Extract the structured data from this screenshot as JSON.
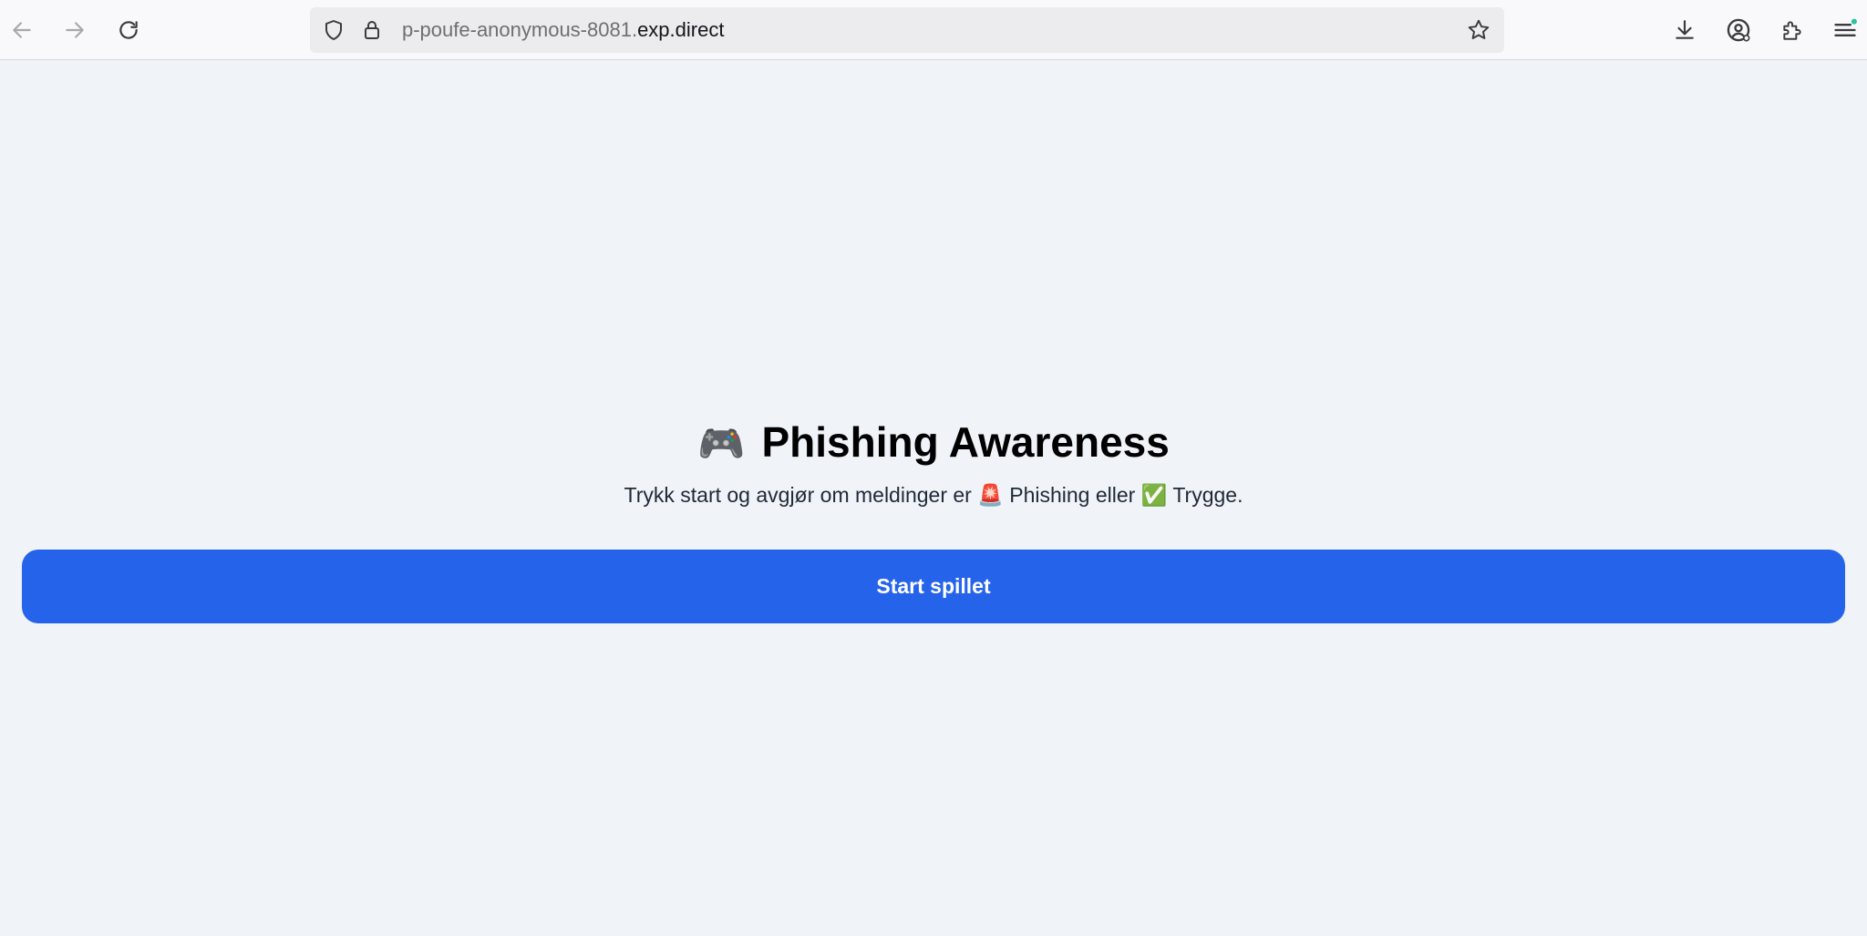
{
  "browser": {
    "url_subdomain": "p-poufe-anonymous-8081.",
    "url_domain": "exp.direct",
    "icons": {
      "back": "arrow-left-icon",
      "forward": "arrow-right-icon",
      "reload": "reload-icon",
      "tracking": "shield-icon",
      "security": "lock-icon",
      "bookmark": "star-icon",
      "downloads": "download-icon",
      "account": "account-icon",
      "extensions": "puzzle-icon",
      "menu": "hamburger-menu-icon"
    },
    "colors": {
      "notification_dot": "#2ac3a2"
    }
  },
  "page": {
    "title_emoji": "🎮",
    "title": "Phishing Awareness",
    "subtitle_prefix": "Trykk start og avgjør om meldinger er ",
    "phishing_emoji": "🚨",
    "phishing_label": " Phishing eller ",
    "safe_emoji": "✅",
    "safe_label": " Trygge.",
    "start_button": "Start spillet",
    "colors": {
      "background": "#f0f3f8",
      "button": "#2563eb",
      "button_text": "#ffffff"
    }
  }
}
